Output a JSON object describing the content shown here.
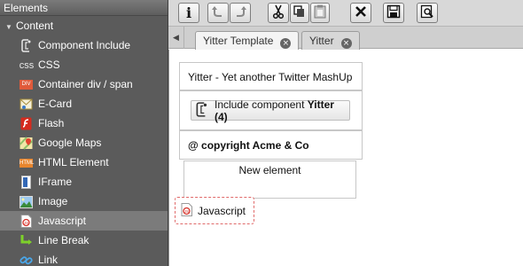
{
  "panel": {
    "title": "Elements",
    "group": "Content",
    "items": [
      {
        "label": "Component Include",
        "icon": "component-include-icon"
      },
      {
        "label": "CSS",
        "icon": "css-icon",
        "icon_text": "css"
      },
      {
        "label": "Container div / span",
        "icon": "container-icon",
        "icon_text": "DIV"
      },
      {
        "label": "E-Card",
        "icon": "ecard-icon"
      },
      {
        "label": "Flash",
        "icon": "flash-icon"
      },
      {
        "label": "Google Maps",
        "icon": "google-maps-icon"
      },
      {
        "label": "HTML Element",
        "icon": "html-element-icon",
        "icon_text": "HTML"
      },
      {
        "label": "IFrame",
        "icon": "iframe-icon"
      },
      {
        "label": "Image",
        "icon": "image-icon"
      },
      {
        "label": "Javascript",
        "icon": "javascript-icon",
        "selected": true
      },
      {
        "label": "Line Break",
        "icon": "line-break-icon"
      },
      {
        "label": "Link",
        "icon": "link-icon"
      }
    ]
  },
  "toolbar": {
    "info_icon_text": "i",
    "buttons": [
      "info-icon",
      "undo-icon",
      "redo-icon",
      "cut-icon",
      "copy-icon",
      "paste-icon",
      "delete-icon",
      "save-icon",
      "preview-icon"
    ]
  },
  "tabs": [
    {
      "label": "Yitter Template",
      "active": true
    },
    {
      "label": "Yitter",
      "active": false
    }
  ],
  "tab_close_glyph": "×",
  "canvas": {
    "title_block": "Yitter - Yet another Twitter MashUp",
    "include_prefix": "Include component",
    "include_name": "Yitter (4)",
    "copyright": "@ copyright Acme & Co",
    "new_element": "New element",
    "dragging": "Javascript"
  },
  "colors": {
    "panel_bg": "#5b5b5b",
    "selected_bg": "#7b7b7b",
    "drag_border": "#e06a6a"
  }
}
